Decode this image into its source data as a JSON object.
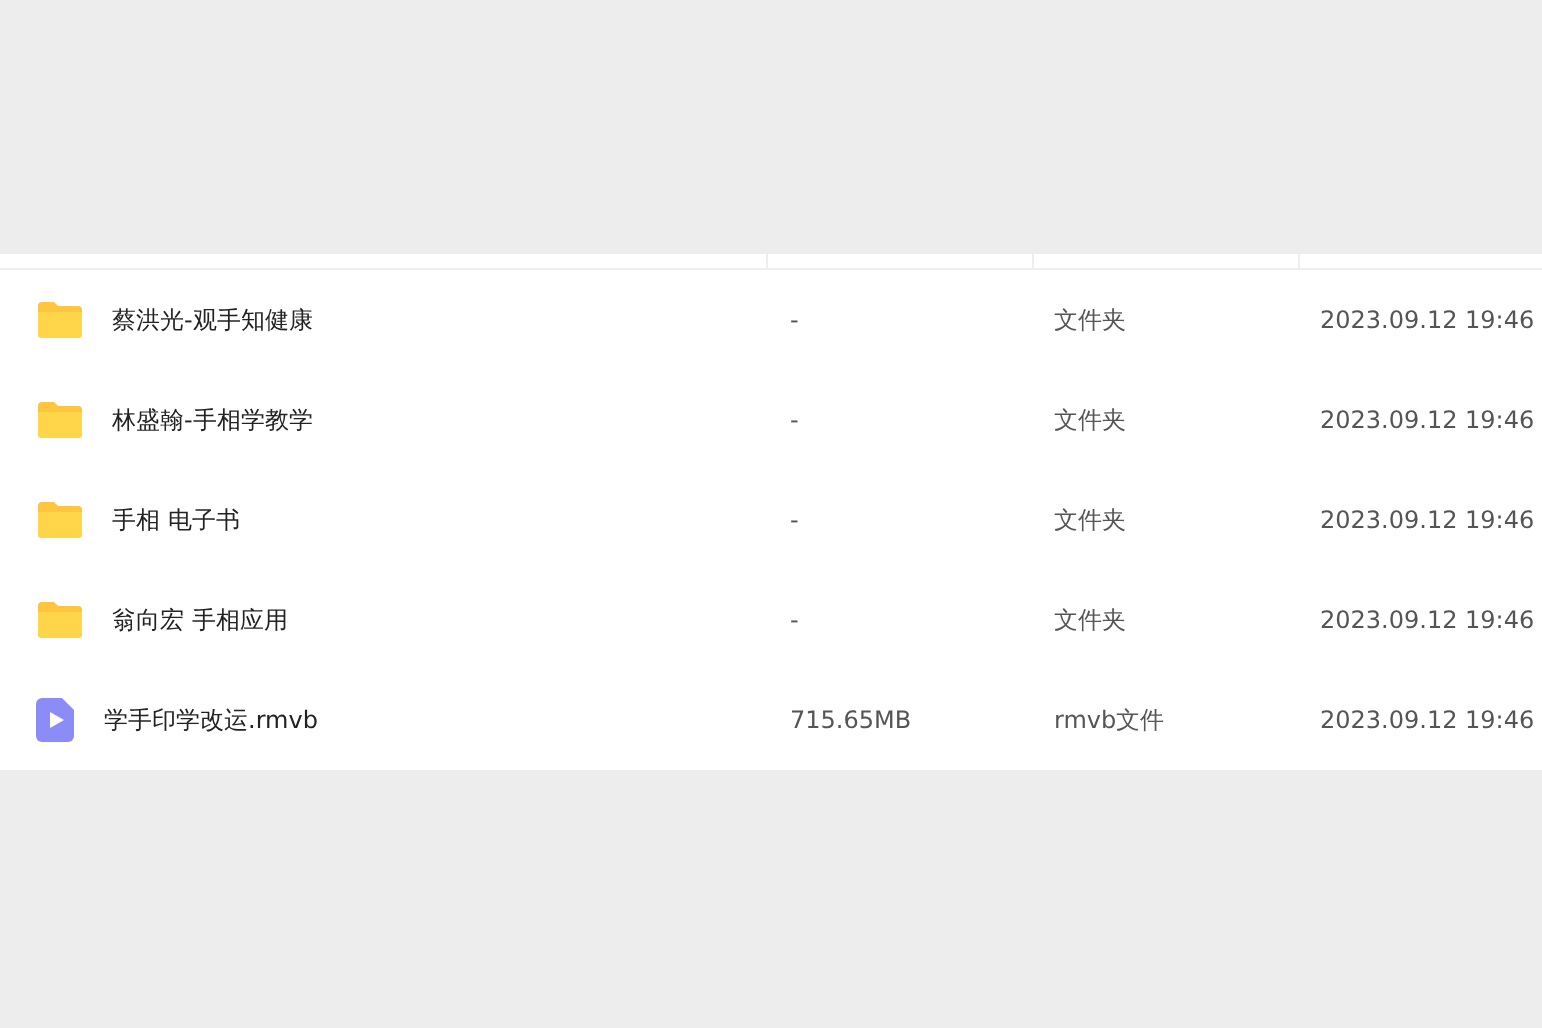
{
  "files": [
    {
      "kind": "folder",
      "name": "蔡洪光-观手知健康",
      "size": "-",
      "type": "文件夹",
      "modified": "2023.09.12 19:46"
    },
    {
      "kind": "folder",
      "name": "林盛翰-手相学教学",
      "size": "-",
      "type": "文件夹",
      "modified": "2023.09.12 19:46"
    },
    {
      "kind": "folder",
      "name": "手相 电子书",
      "size": "-",
      "type": "文件夹",
      "modified": "2023.09.12 19:46"
    },
    {
      "kind": "folder",
      "name": "翁向宏 手相应用",
      "size": "-",
      "type": "文件夹",
      "modified": "2023.09.12 19:46"
    },
    {
      "kind": "video",
      "name": "学手印学改运.rmvb",
      "size": "715.65MB",
      "type": "rmvb文件",
      "modified": "2023.09.12 19:46"
    }
  ]
}
